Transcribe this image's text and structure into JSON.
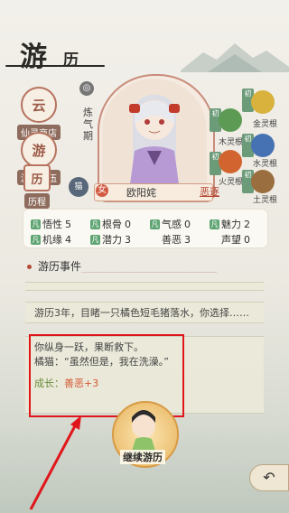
{
  "header": {
    "title_main": "游",
    "title_sub": "历"
  },
  "nav": [
    {
      "label": "仙灵商店",
      "glyph": "云"
    },
    {
      "label": "游历队伍",
      "glyph": "游"
    },
    {
      "label": "历程",
      "glyph": "历"
    }
  ],
  "character": {
    "realm": "炼气期",
    "gender": "女",
    "name": "欧阳姹",
    "tag": "恶逐"
  },
  "spirit_roots": [
    {
      "badge": "初",
      "name": "金灵根",
      "color": "#d8b23c",
      "glyph": "金"
    },
    {
      "badge": "初",
      "name": "木灵根",
      "color": "#5d9b55",
      "glyph": "木"
    },
    {
      "badge": "初",
      "name": "水灵根",
      "color": "#4672b4",
      "glyph": "水"
    },
    {
      "badge": "初",
      "name": "火灵根",
      "color": "#d2652f",
      "glyph": "火"
    },
    {
      "badge": "初",
      "name": "土灵根",
      "color": "#9a6e3e",
      "glyph": "土"
    }
  ],
  "stats": [
    {
      "fan": "凡",
      "label": "悟性",
      "value": "5"
    },
    {
      "fan": "凡",
      "label": "根骨",
      "value": "0"
    },
    {
      "fan": "凡",
      "label": "气感",
      "value": "0"
    },
    {
      "fan": "凡",
      "label": "魅力",
      "value": "2"
    },
    {
      "fan": "凡",
      "label": "机缘",
      "value": "4"
    },
    {
      "fan": "凡",
      "label": "潜力",
      "value": "3"
    },
    {
      "fan": "",
      "label": "善恶",
      "value": "3"
    },
    {
      "fan": "",
      "label": "声望",
      "value": "0"
    }
  ],
  "events": {
    "header": "游历事件",
    "entry1": "游历3年，目睹一只橘色短毛猪落水，你选择……",
    "entry2_line1": "你纵身一跃，果断救下。",
    "entry2_line2": "橘猫：“虽然但是，我在洗澡。”",
    "growth_label": "成长：",
    "growth_value": "善恶+3"
  },
  "bottom": {
    "start_label": "继续游历",
    "back_glyph": "↶"
  },
  "colors": {
    "annotation_red": "#e0161b",
    "accent": "#b34a39"
  }
}
